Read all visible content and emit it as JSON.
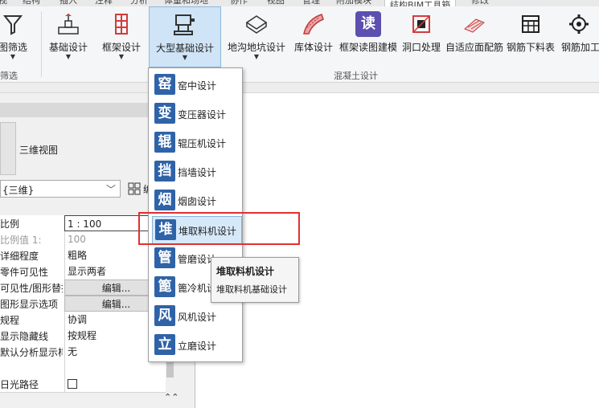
{
  "tabs": [
    {
      "label": "视"
    },
    {
      "label": "结构"
    },
    {
      "label": "插入"
    },
    {
      "label": "注释"
    },
    {
      "label": "分析"
    },
    {
      "label": "体量和场地"
    },
    {
      "label": "协作"
    },
    {
      "label": "视图"
    },
    {
      "label": "管理"
    },
    {
      "label": "附加模块"
    },
    {
      "label": "结构BIM工具箱"
    },
    {
      "label": "修改"
    }
  ],
  "ribbon": {
    "filter_label": "图筛选",
    "filter_group": "筛选",
    "buttons": [
      {
        "label": "基础设计",
        "icon": "foundation-icon"
      },
      {
        "label": "框架设计",
        "icon": "frame-building-icon"
      },
      {
        "label": "大型基础设计",
        "icon": "large-foundation-icon"
      },
      {
        "label": "地沟地坑设计",
        "icon": "pit-icon"
      },
      {
        "label": "库体设计",
        "icon": "silo-icon"
      },
      {
        "label": "框架读图建模",
        "icon": "read-drawing-icon"
      },
      {
        "label": "洞口处理",
        "icon": "opening-icon"
      },
      {
        "label": "自适应面配筋",
        "icon": "adaptive-rebar-icon"
      },
      {
        "label": "钢筋下料表",
        "icon": "rebar-schedule-icon"
      },
      {
        "label": "钢筋加工",
        "icon": "rebar-process-icon"
      }
    ],
    "group_label": "混凝土设计",
    "read_icon_text": "读"
  },
  "dropdown": {
    "items": [
      {
        "glyph": "窑",
        "label": "窑中设计"
      },
      {
        "glyph": "变",
        "label": "变压器设计"
      },
      {
        "glyph": "辊",
        "label": "辊压机设计"
      },
      {
        "glyph": "挡",
        "label": "挡墙设计"
      },
      {
        "glyph": "烟",
        "label": "烟囱设计"
      },
      {
        "glyph": "堆",
        "label": "堆取料机设计"
      },
      {
        "glyph": "管",
        "label": "管磨设计"
      },
      {
        "glyph": "篦",
        "label": "篦冷机设计"
      },
      {
        "glyph": "风",
        "label": "风机设计"
      },
      {
        "glyph": "立",
        "label": "立磨设计"
      }
    ]
  },
  "tooltip": {
    "title": "堆取料机设计",
    "desc": "堆取料机基础设计"
  },
  "properties": {
    "view_name": "三维视图",
    "view_type": "{三维}",
    "edit_type": "编",
    "rows": [
      {
        "key": "比例",
        "value": "1 : 100"
      },
      {
        "key": "比例值 1:",
        "value": "100"
      },
      {
        "key": "详细程度",
        "value": "粗略"
      },
      {
        "key": "零件可见性",
        "value": "显示两者"
      },
      {
        "key": "可见性/图形替换",
        "value": "编辑..."
      },
      {
        "key": "图形显示选项",
        "value": "编辑..."
      },
      {
        "key": "规程",
        "value": "协调"
      },
      {
        "key": "显示隐藏线",
        "value": "按规程"
      },
      {
        "key": "默认分析显示样式",
        "value": "无"
      },
      {
        "key": "",
        "value": ""
      },
      {
        "key": "日光路径",
        "value": ""
      }
    ]
  }
}
